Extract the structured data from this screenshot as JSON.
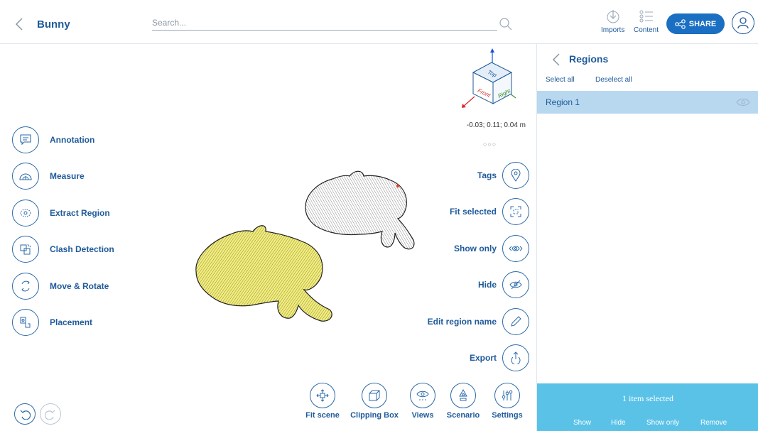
{
  "header": {
    "title": "Bunny",
    "search_placeholder": "Search...",
    "imports_label": "Imports",
    "content_label": "Content",
    "share_label": "SHARE"
  },
  "left_tools": [
    {
      "label": "Annotation",
      "icon": "comment-icon"
    },
    {
      "label": "Measure",
      "icon": "measure-icon"
    },
    {
      "label": "Extract Region",
      "icon": "extract-region-icon"
    },
    {
      "label": "Clash Detection",
      "icon": "clash-detection-icon"
    },
    {
      "label": "Move & Rotate",
      "icon": "move-rotate-icon"
    },
    {
      "label": "Placement",
      "icon": "placement-icon"
    }
  ],
  "viewport": {
    "coords": "-0.03; 0.11; 0.04 m",
    "more": "○○○",
    "cube": {
      "top": "Top",
      "front": "Front",
      "right": "Right"
    }
  },
  "right_tools": [
    {
      "label": "Tags",
      "icon": "map-pin-icon"
    },
    {
      "label": "Fit selected",
      "icon": "fit-selected-icon"
    },
    {
      "label": "Show only",
      "icon": "show-only-icon"
    },
    {
      "label": "Hide",
      "icon": "hide-eye-icon"
    },
    {
      "label": "Edit region name",
      "icon": "pencil-icon"
    },
    {
      "label": "Export",
      "icon": "export-icon"
    }
  ],
  "bottom_tools": [
    {
      "label": "Fit scene",
      "icon": "fit-scene-icon"
    },
    {
      "label": "Clipping Box",
      "icon": "clipping-box-icon"
    },
    {
      "label": "Views",
      "icon": "views-icon"
    },
    {
      "label": "Scenario",
      "icon": "scenario-icon"
    },
    {
      "label": "Settings",
      "icon": "settings-sliders-icon"
    }
  ],
  "panel": {
    "title": "Regions",
    "select_all": "Select all",
    "deselect_all": "Deselect all",
    "regions": [
      {
        "label": "Region 1",
        "selected": true
      }
    ],
    "status": "1 item selected",
    "actions": [
      "Show",
      "Hide",
      "Show only",
      "Remove"
    ]
  },
  "colors": {
    "accent": "#1a6fc2",
    "text": "#1f5a9a",
    "selected_row": "#b8d8ef",
    "footer": "#5bc2e7",
    "bunny_selected": "#f3ee7a"
  }
}
